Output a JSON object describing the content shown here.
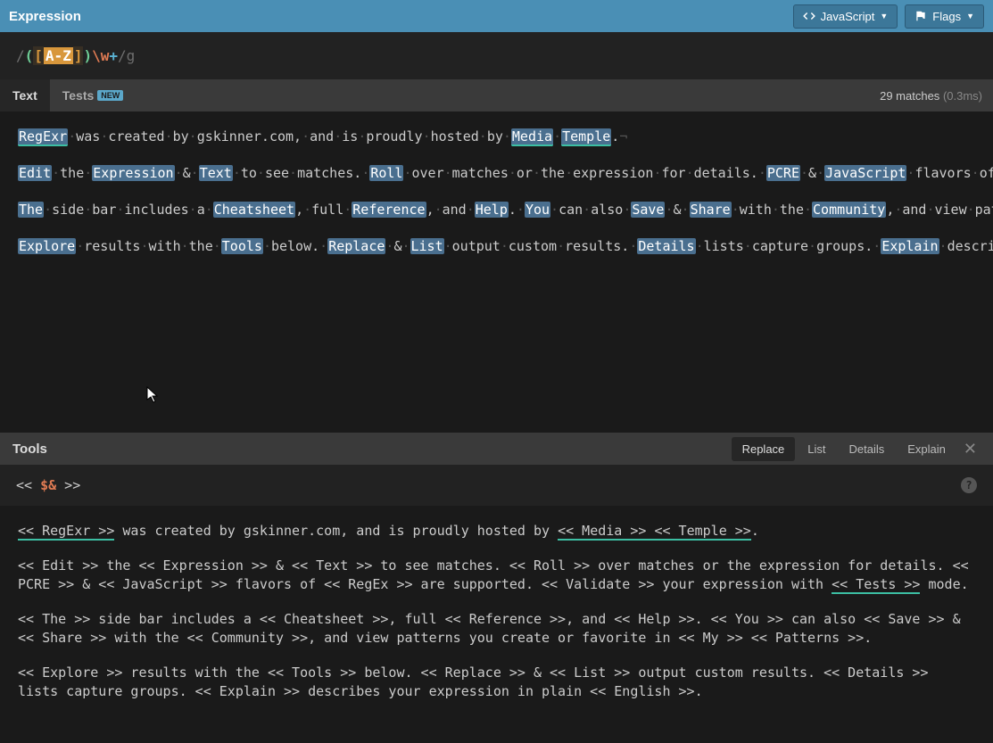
{
  "header": {
    "title": "Expression",
    "js_button": "JavaScript",
    "flags_button": "Flags"
  },
  "expression": {
    "open_delim": "/",
    "open_paren": "(",
    "open_bracket": "[",
    "range": "A-Z",
    "close_bracket": "]",
    "close_paren": ")",
    "escape": "\\w",
    "quant": "+",
    "close_delim": "/",
    "flags": "g"
  },
  "tabs": {
    "text": "Text",
    "tests": "Tests",
    "new_badge": "NEW"
  },
  "match_info": {
    "matches": "29 matches",
    "time": "(0.3ms)"
  },
  "matches": [
    "RegExr",
    "Media",
    "Temple",
    "Edit",
    "Expression",
    "Text",
    "Roll",
    "PCRE",
    "JavaScript",
    "RegEx",
    "Validate",
    "Tests",
    "The",
    "Cheatsheet",
    "Reference",
    "Help",
    "You",
    "Save",
    "Share",
    "Community",
    "My",
    "Patterns",
    "Explore",
    "Tools",
    "Replace",
    "List",
    "Details",
    "Explain",
    "English"
  ],
  "sample_text": {
    "p1_a": " was created by gskinner.com, and is proudly hosted by ",
    "p1_b": " ",
    "p1_c": ".",
    "p2_a": " the ",
    "p2_b": " & ",
    "p2_c": " to see matches. ",
    "p2_d": " over matches or the expression for details. ",
    "p2_e": " & ",
    "p2_f": " flavors of ",
    "p2_g": " are supported. ",
    "p2_h": " your expression with ",
    "p2_i": " mode.",
    "p3_a": " side bar includes a ",
    "p3_b": ", full ",
    "p3_c": ", and ",
    "p3_d": ". ",
    "p3_e": " can also ",
    "p3_f": " & ",
    "p3_g": " with the ",
    "p3_h": ", and view patterns you create or favorite in ",
    "p3_i": " ",
    "p3_j": ".",
    "p4_a": " results with the ",
    "p4_b": " below. ",
    "p4_c": " & ",
    "p4_d": " output custom results. ",
    "p4_e": " lists capture groups. ",
    "p4_f": " describes your expression in plain ",
    "p4_g": "."
  },
  "tools": {
    "title": "Tools",
    "tabs": {
      "replace": "Replace",
      "list": "List",
      "details": "Details",
      "explain": "Explain"
    }
  },
  "replace": {
    "prefix": "<< ",
    "subst": "$&",
    "suffix": " >>"
  },
  "output": {
    "p1": "<< RegExr >> was created by gskinner.com, and is proudly hosted by << Media >> << Temple >>.",
    "p2": "<< Edit >> the << Expression >> & << Text >> to see matches. << Roll >> over matches or the expression for details. << PCRE >> & << JavaScript >> flavors of << RegEx >> are supported. << Validate >> your expression with << Tests >> mode.",
    "p3": "<< The >> side bar includes a << Cheatsheet >>, full << Reference >>, and << Help >>. << You >> can also << Save >> & << Share >> with the << Community >>, and view patterns you create or favorite in << My >> << Patterns >>.",
    "p4": "<< Explore >> results with the << Tools >> below. << Replace >> & << List >> output custom results. << Details >> lists capture groups. << Explain >> describes your expression in plain << English >>."
  },
  "output_underlines": {
    "p1": [
      "<< RegExr >>",
      "<< Media >> << Temple >>"
    ],
    "p2_tail": "<< Tests >>"
  }
}
